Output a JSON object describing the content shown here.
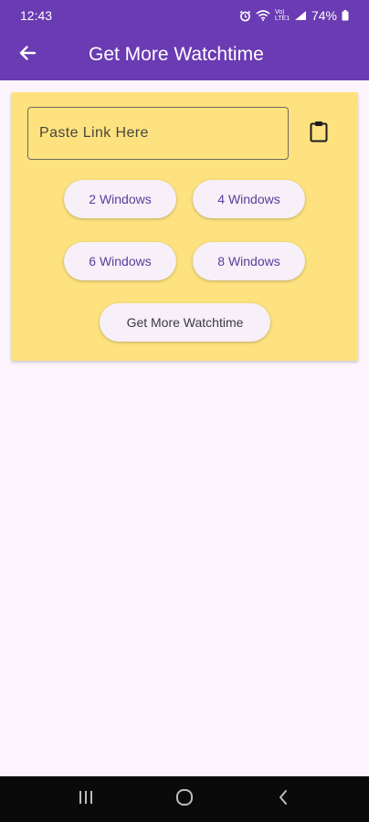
{
  "status_bar": {
    "time": "12:43",
    "network_label": "Vo) LTE1",
    "battery": "74%"
  },
  "toolbar": {
    "back_icon": "arrow-left-icon",
    "title": "Get More Watchtime"
  },
  "form": {
    "link_placeholder": "Paste Link Here",
    "link_value": "",
    "paste_icon": "clipboard-icon"
  },
  "window_options": [
    {
      "label": "2 Windows"
    },
    {
      "label": "4 Windows"
    },
    {
      "label": "6 Windows"
    },
    {
      "label": "8 Windows"
    }
  ],
  "submit_label": "Get More Watchtime",
  "navigation": {
    "recents_icon": "recents-icon",
    "home_icon": "home-icon",
    "back_icon": "back-chevron-icon"
  },
  "colors": {
    "app_bar": "#6a3bb3",
    "card": "#fde27f",
    "background": "#fcf5fd",
    "pill": "#f7f0f8",
    "pill_text": "#5a3c9a"
  }
}
